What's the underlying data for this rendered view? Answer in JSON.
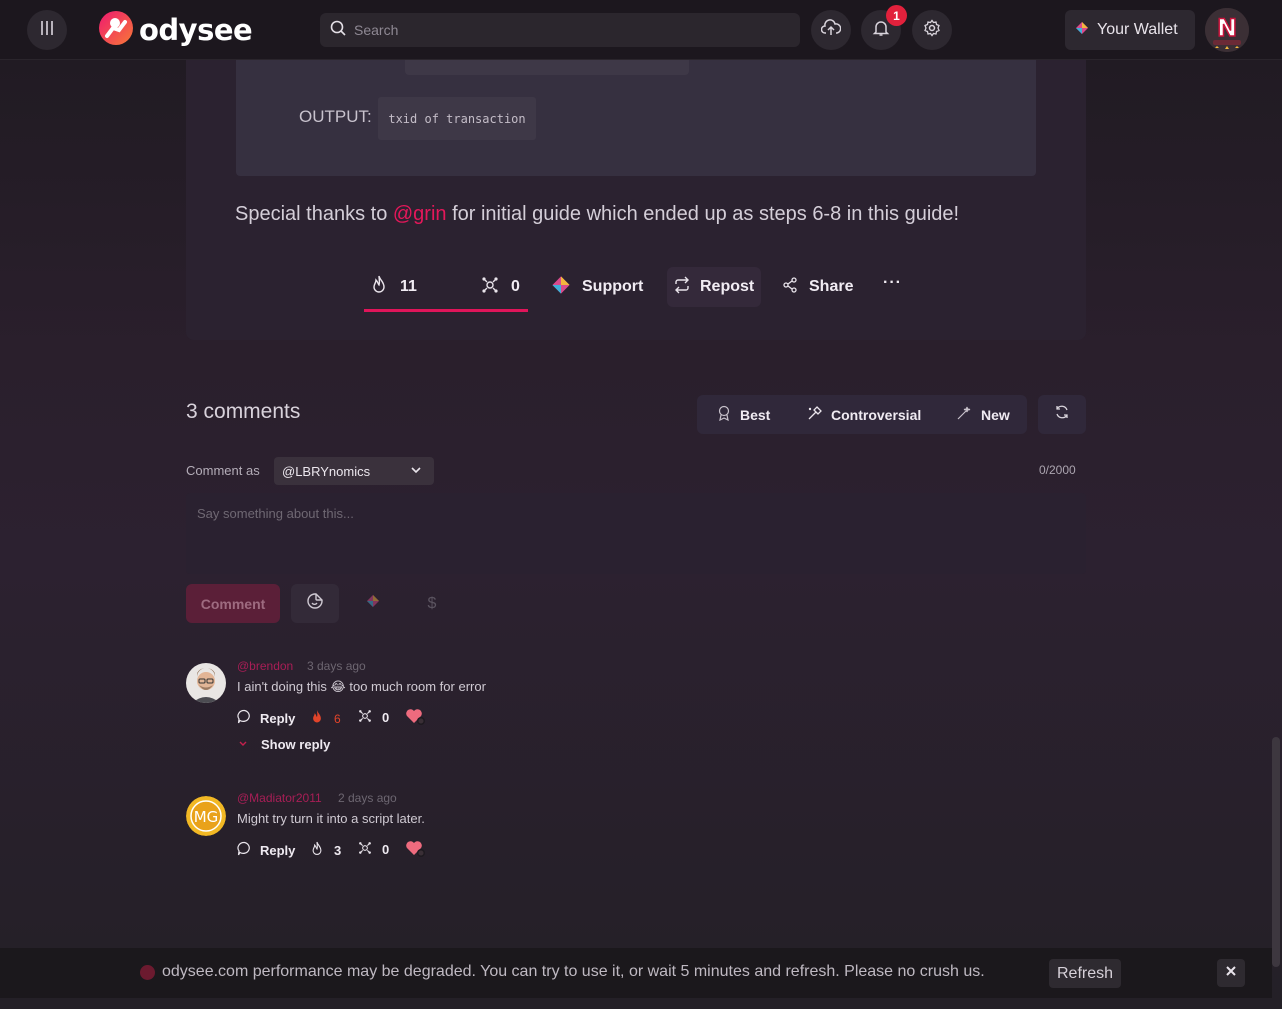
{
  "header": {
    "logo_text": "odysee",
    "search_placeholder": "Search",
    "notification_count": "1",
    "wallet_label": "Your Wallet"
  },
  "post": {
    "output_label": "OUTPUT:",
    "output_code": "txid of transaction",
    "thanks_prefix": "Special thanks to ",
    "thanks_mention": "@grin",
    "thanks_suffix": " for initial guide which ended up as steps 6-8 in this guide!",
    "actions": {
      "fire_count": "11",
      "slime_count": "0",
      "support_label": "Support",
      "repost_label": "Repost",
      "share_label": "Share",
      "more_label": "···"
    }
  },
  "comments": {
    "title": "3 comments",
    "sort": {
      "best": "Best",
      "controversial": "Controversial",
      "new": "New"
    },
    "comment_as_label": "Comment as",
    "channel": "@LBRYnomics",
    "char_count": "0/2000",
    "placeholder": "Say something about this...",
    "submit_label": "Comment",
    "items": [
      {
        "author": "@brendon",
        "time": "3 days ago",
        "text_before": "I ain't doing this ",
        "emoji": "😂",
        "text_after": " too much room for error",
        "reply_label": "Reply",
        "fire_count": "6",
        "slime_count": "0",
        "show_reply": "Show reply"
      },
      {
        "author": "@Madiator2011",
        "time": "2 days ago",
        "text": "Might try turn it into a script later.",
        "reply_label": "Reply",
        "fire_count": "3",
        "slime_count": "0"
      }
    ]
  },
  "banner": {
    "text": "odysee.com performance may be degraded. You can try to use it, or wait 5 minutes and refresh. Please no crush us.",
    "refresh_label": "Refresh"
  },
  "colors": {
    "accent": "#e5175a",
    "background": "#221d25",
    "header": "#1c171e"
  }
}
